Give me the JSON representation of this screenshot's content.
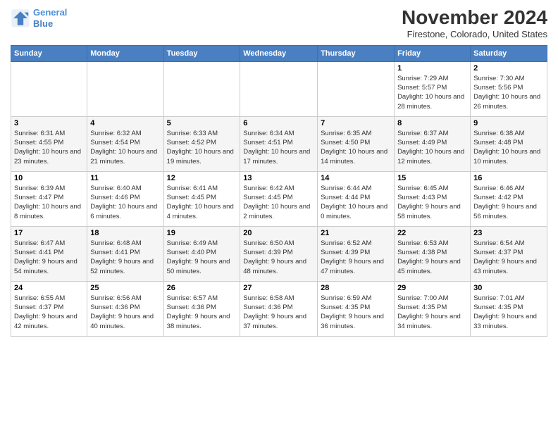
{
  "header": {
    "logo_line1": "General",
    "logo_line2": "Blue",
    "month": "November 2024",
    "location": "Firestone, Colorado, United States"
  },
  "columns": [
    "Sunday",
    "Monday",
    "Tuesday",
    "Wednesday",
    "Thursday",
    "Friday",
    "Saturday"
  ],
  "weeks": [
    [
      {
        "day": "",
        "info": ""
      },
      {
        "day": "",
        "info": ""
      },
      {
        "day": "",
        "info": ""
      },
      {
        "day": "",
        "info": ""
      },
      {
        "day": "",
        "info": ""
      },
      {
        "day": "1",
        "info": "Sunrise: 7:29 AM\nSunset: 5:57 PM\nDaylight: 10 hours and 28 minutes."
      },
      {
        "day": "2",
        "info": "Sunrise: 7:30 AM\nSunset: 5:56 PM\nDaylight: 10 hours and 26 minutes."
      }
    ],
    [
      {
        "day": "3",
        "info": "Sunrise: 6:31 AM\nSunset: 4:55 PM\nDaylight: 10 hours and 23 minutes."
      },
      {
        "day": "4",
        "info": "Sunrise: 6:32 AM\nSunset: 4:54 PM\nDaylight: 10 hours and 21 minutes."
      },
      {
        "day": "5",
        "info": "Sunrise: 6:33 AM\nSunset: 4:52 PM\nDaylight: 10 hours and 19 minutes."
      },
      {
        "day": "6",
        "info": "Sunrise: 6:34 AM\nSunset: 4:51 PM\nDaylight: 10 hours and 17 minutes."
      },
      {
        "day": "7",
        "info": "Sunrise: 6:35 AM\nSunset: 4:50 PM\nDaylight: 10 hours and 14 minutes."
      },
      {
        "day": "8",
        "info": "Sunrise: 6:37 AM\nSunset: 4:49 PM\nDaylight: 10 hours and 12 minutes."
      },
      {
        "day": "9",
        "info": "Sunrise: 6:38 AM\nSunset: 4:48 PM\nDaylight: 10 hours and 10 minutes."
      }
    ],
    [
      {
        "day": "10",
        "info": "Sunrise: 6:39 AM\nSunset: 4:47 PM\nDaylight: 10 hours and 8 minutes."
      },
      {
        "day": "11",
        "info": "Sunrise: 6:40 AM\nSunset: 4:46 PM\nDaylight: 10 hours and 6 minutes."
      },
      {
        "day": "12",
        "info": "Sunrise: 6:41 AM\nSunset: 4:45 PM\nDaylight: 10 hours and 4 minutes."
      },
      {
        "day": "13",
        "info": "Sunrise: 6:42 AM\nSunset: 4:45 PM\nDaylight: 10 hours and 2 minutes."
      },
      {
        "day": "14",
        "info": "Sunrise: 6:44 AM\nSunset: 4:44 PM\nDaylight: 10 hours and 0 minutes."
      },
      {
        "day": "15",
        "info": "Sunrise: 6:45 AM\nSunset: 4:43 PM\nDaylight: 9 hours and 58 minutes."
      },
      {
        "day": "16",
        "info": "Sunrise: 6:46 AM\nSunset: 4:42 PM\nDaylight: 9 hours and 56 minutes."
      }
    ],
    [
      {
        "day": "17",
        "info": "Sunrise: 6:47 AM\nSunset: 4:41 PM\nDaylight: 9 hours and 54 minutes."
      },
      {
        "day": "18",
        "info": "Sunrise: 6:48 AM\nSunset: 4:41 PM\nDaylight: 9 hours and 52 minutes."
      },
      {
        "day": "19",
        "info": "Sunrise: 6:49 AM\nSunset: 4:40 PM\nDaylight: 9 hours and 50 minutes."
      },
      {
        "day": "20",
        "info": "Sunrise: 6:50 AM\nSunset: 4:39 PM\nDaylight: 9 hours and 48 minutes."
      },
      {
        "day": "21",
        "info": "Sunrise: 6:52 AM\nSunset: 4:39 PM\nDaylight: 9 hours and 47 minutes."
      },
      {
        "day": "22",
        "info": "Sunrise: 6:53 AM\nSunset: 4:38 PM\nDaylight: 9 hours and 45 minutes."
      },
      {
        "day": "23",
        "info": "Sunrise: 6:54 AM\nSunset: 4:37 PM\nDaylight: 9 hours and 43 minutes."
      }
    ],
    [
      {
        "day": "24",
        "info": "Sunrise: 6:55 AM\nSunset: 4:37 PM\nDaylight: 9 hours and 42 minutes."
      },
      {
        "day": "25",
        "info": "Sunrise: 6:56 AM\nSunset: 4:36 PM\nDaylight: 9 hours and 40 minutes."
      },
      {
        "day": "26",
        "info": "Sunrise: 6:57 AM\nSunset: 4:36 PM\nDaylight: 9 hours and 38 minutes."
      },
      {
        "day": "27",
        "info": "Sunrise: 6:58 AM\nSunset: 4:36 PM\nDaylight: 9 hours and 37 minutes."
      },
      {
        "day": "28",
        "info": "Sunrise: 6:59 AM\nSunset: 4:35 PM\nDaylight: 9 hours and 36 minutes."
      },
      {
        "day": "29",
        "info": "Sunrise: 7:00 AM\nSunset: 4:35 PM\nDaylight: 9 hours and 34 minutes."
      },
      {
        "day": "30",
        "info": "Sunrise: 7:01 AM\nSunset: 4:35 PM\nDaylight: 9 hours and 33 minutes."
      }
    ]
  ]
}
